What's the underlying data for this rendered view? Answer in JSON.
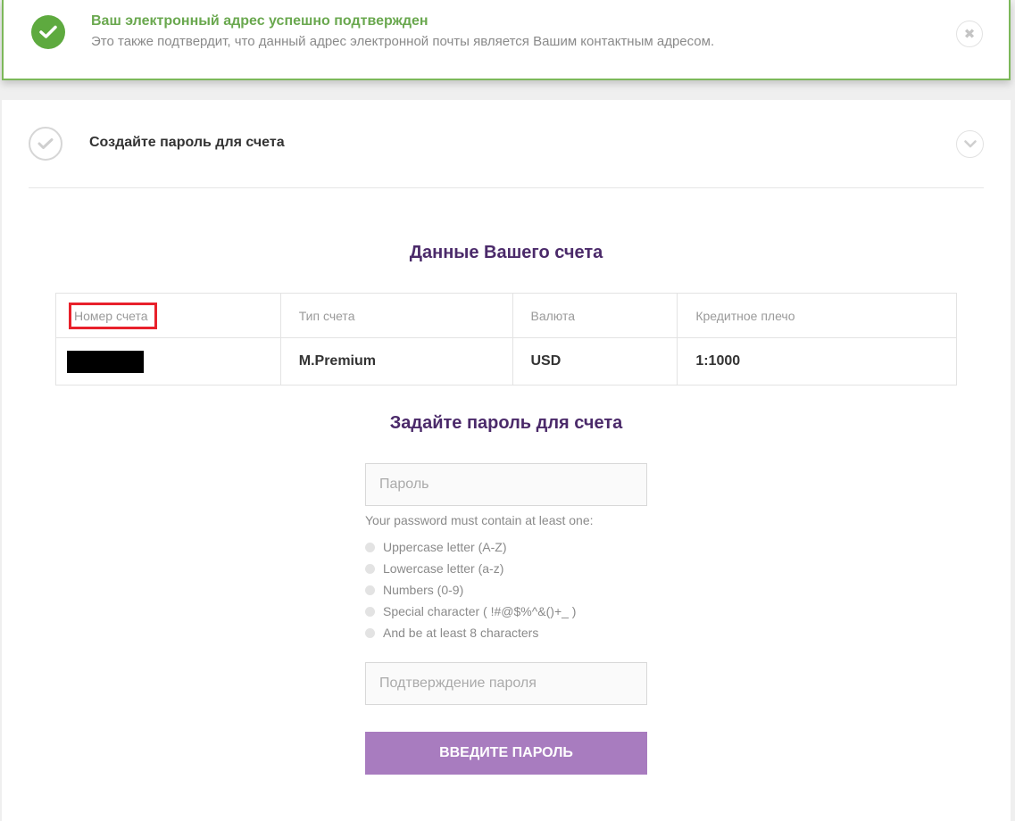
{
  "banner": {
    "title": "Ваш электронный адрес успешно подтвержден",
    "subtitle": "Это также подтвердит, что данный адрес электронной почты является Вашим контактным адресом.",
    "close_glyph": "✖"
  },
  "step": {
    "title": "Создайте пароль для счета"
  },
  "account": {
    "title": "Данные Вашего счета",
    "columns": [
      "Номер счета",
      "Тип счета",
      "Валюта",
      "Кредитное плечо"
    ],
    "row": {
      "type": "M.Premium",
      "currency": "USD",
      "leverage": "1:1000"
    }
  },
  "password": {
    "title": "Задайте пароль для счета",
    "password_placeholder": "Пароль",
    "rules_intro": "Your password must contain at least one:",
    "rules": [
      "Uppercase letter (A-Z)",
      "Lowercase letter (a-z)",
      "Numbers (0-9)",
      "Special character ( !#@$%^&()+_ )",
      "And be at least 8 characters"
    ],
    "confirm_placeholder": "Подтверждение пароля",
    "submit_label": "ВВЕДИТЕ ПАРОЛЬ"
  },
  "colors": {
    "success": "#5eaa3f",
    "heading": "#4b2a6a",
    "button": "#a87cbf",
    "highlight": "#e8212b"
  }
}
